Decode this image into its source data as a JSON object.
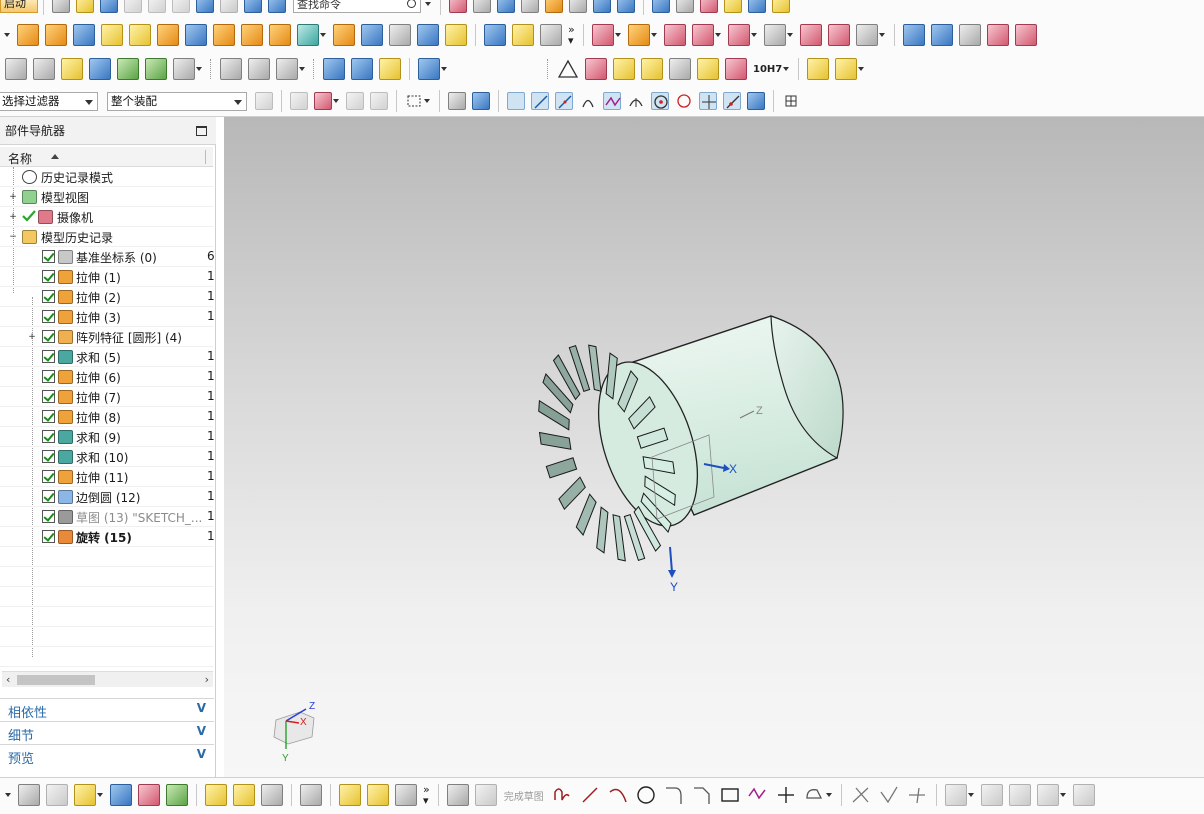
{
  "app": {
    "start_menu": "启动"
  },
  "search": {
    "placeholder": "查找命令"
  },
  "filters": {
    "selection_filter": "选择过滤器",
    "assembly_scope": "整个装配"
  },
  "toolbar": {
    "tolerance_label": "10H7"
  },
  "navigator": {
    "title": "部件导航器",
    "column_name": "名称",
    "items": [
      {
        "label": "历史记录模式",
        "icon": "clock-icon",
        "col2": "",
        "checked": false
      },
      {
        "label": "模型视图",
        "icon": "model-views-icon",
        "col2": "",
        "checked": false
      },
      {
        "label": "摄像机",
        "icon": "camera-icon",
        "col2": "",
        "checked": true
      },
      {
        "label": "模型历史记录",
        "icon": "folder-icon",
        "col2": "",
        "checked": false
      },
      {
        "label": "基准坐标系 (0)",
        "icon": "datum-csys-icon",
        "col2": "6",
        "checked": true
      },
      {
        "label": "拉伸 (1)",
        "icon": "extrude-icon",
        "col2": "1",
        "checked": true
      },
      {
        "label": "拉伸 (2)",
        "icon": "extrude-icon",
        "col2": "1",
        "checked": true
      },
      {
        "label": "拉伸 (3)",
        "icon": "extrude-icon",
        "col2": "1",
        "checked": true
      },
      {
        "label": "阵列特征 [圆形] (4)",
        "icon": "pattern-feature-icon",
        "col2": "",
        "checked": true
      },
      {
        "label": "求和 (5)",
        "icon": "unite-icon",
        "col2": "1",
        "checked": true
      },
      {
        "label": "拉伸 (6)",
        "icon": "extrude-icon",
        "col2": "1",
        "checked": true
      },
      {
        "label": "拉伸 (7)",
        "icon": "extrude-icon",
        "col2": "1",
        "checked": true
      },
      {
        "label": "拉伸 (8)",
        "icon": "extrude-icon",
        "col2": "1",
        "checked": true
      },
      {
        "label": "求和 (9)",
        "icon": "unite-icon",
        "col2": "1",
        "checked": true
      },
      {
        "label": "求和 (10)",
        "icon": "unite-icon",
        "col2": "1",
        "checked": true
      },
      {
        "label": "拉伸 (11)",
        "icon": "extrude-icon",
        "col2": "1",
        "checked": true
      },
      {
        "label": "边倒圆 (12)",
        "icon": "edge-blend-icon",
        "col2": "1",
        "checked": true
      },
      {
        "label": "草图 (13) \"SKETCH_...",
        "icon": "sketch-icon",
        "col2": "1",
        "checked": true
      },
      {
        "label": "旋转 (15)",
        "icon": "revolve-icon",
        "col2": "1",
        "checked": true
      }
    ],
    "sections": [
      "相依性",
      "细节",
      "预览"
    ]
  },
  "viewport": {
    "axis_labels": {
      "x": "X",
      "y": "Y",
      "z": "Z"
    },
    "triad_labels": {
      "x": "X",
      "y": "Y",
      "z": "Z"
    }
  },
  "bottom_bar": {
    "finish_sketch": "完成草图"
  }
}
